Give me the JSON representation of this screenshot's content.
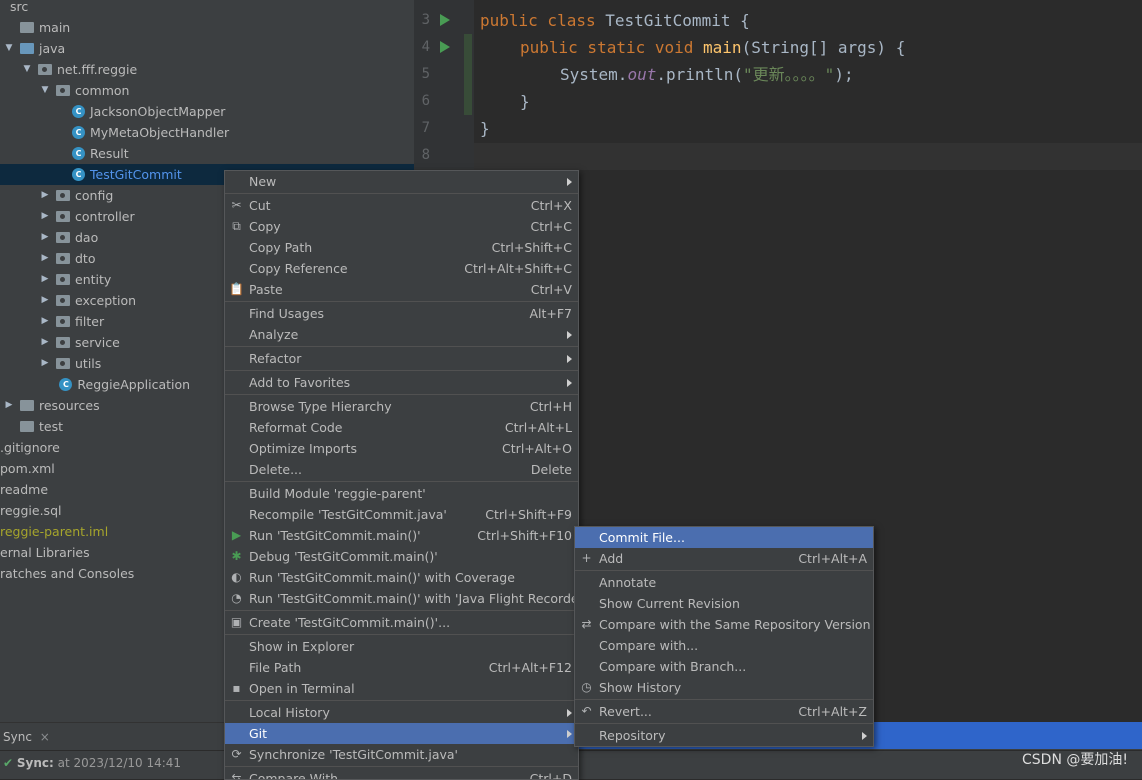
{
  "tree": [
    {
      "label": "src",
      "depth": 0,
      "arrow": "",
      "icon": "none",
      "color": "normal"
    },
    {
      "label": "main",
      "depth": 0,
      "arrow": "",
      "icon": "folder",
      "color": "normal"
    },
    {
      "label": "java",
      "depth": 0,
      "arrow": "down",
      "icon": "folder-blue",
      "color": "normal"
    },
    {
      "label": "net.fff.reggie",
      "depth": 1,
      "arrow": "down",
      "icon": "package",
      "color": "normal"
    },
    {
      "label": "common",
      "depth": 2,
      "arrow": "down",
      "icon": "package",
      "color": "normal"
    },
    {
      "label": "JacksonObjectMapper",
      "depth": 3,
      "arrow": "",
      "icon": "class",
      "color": "normal"
    },
    {
      "label": "MyMetaObjectHandler",
      "depth": 3,
      "arrow": "",
      "icon": "class",
      "color": "normal"
    },
    {
      "label": "Result",
      "depth": 3,
      "arrow": "",
      "icon": "class",
      "color": "normal"
    },
    {
      "label": "TestGitCommit",
      "depth": 3,
      "arrow": "",
      "icon": "class",
      "color": "blue",
      "selected": true
    },
    {
      "label": "config",
      "depth": 2,
      "arrow": "right",
      "icon": "package",
      "color": "normal"
    },
    {
      "label": "controller",
      "depth": 2,
      "arrow": "right",
      "icon": "package",
      "color": "normal"
    },
    {
      "label": "dao",
      "depth": 2,
      "arrow": "right",
      "icon": "package",
      "color": "normal"
    },
    {
      "label": "dto",
      "depth": 2,
      "arrow": "right",
      "icon": "package",
      "color": "normal"
    },
    {
      "label": "entity",
      "depth": 2,
      "arrow": "right",
      "icon": "package",
      "color": "normal"
    },
    {
      "label": "exception",
      "depth": 2,
      "arrow": "right",
      "icon": "package",
      "color": "normal"
    },
    {
      "label": "filter",
      "depth": 2,
      "arrow": "right",
      "icon": "package",
      "color": "normal"
    },
    {
      "label": "service",
      "depth": 2,
      "arrow": "right",
      "icon": "package",
      "color": "normal"
    },
    {
      "label": "utils",
      "depth": 2,
      "arrow": "right",
      "icon": "package",
      "color": "normal"
    },
    {
      "label": "ReggieApplication",
      "depth": 2.3,
      "arrow": "",
      "icon": "class",
      "color": "normal"
    },
    {
      "label": "resources",
      "depth": 0,
      "arrow": "right",
      "icon": "folder",
      "color": "normal"
    },
    {
      "label": "test",
      "depth": 0,
      "arrow": "",
      "icon": "folder",
      "color": "normal"
    },
    {
      "label": ".gitignore",
      "depth": -1,
      "arrow": "",
      "icon": "none",
      "color": "normal"
    },
    {
      "label": "pom.xml",
      "depth": -1,
      "arrow": "",
      "icon": "none",
      "color": "normal"
    },
    {
      "label": "readme",
      "depth": -1,
      "arrow": "",
      "icon": "none",
      "color": "normal"
    },
    {
      "label": "reggie.sql",
      "depth": -1,
      "arrow": "",
      "icon": "none",
      "color": "normal"
    },
    {
      "label": "reggie-parent.iml",
      "depth": -1,
      "arrow": "",
      "icon": "none",
      "color": "yellow"
    },
    {
      "label": "ernal Libraries",
      "depth": -1.3,
      "arrow": "",
      "icon": "none",
      "color": "normal"
    },
    {
      "label": "ratches and Consoles",
      "depth": -1.3,
      "arrow": "",
      "icon": "none",
      "color": "normal"
    }
  ],
  "editor": {
    "lines": [
      {
        "num": "3",
        "run": true
      },
      {
        "num": "4",
        "run": true
      },
      {
        "num": "5",
        "run": false
      },
      {
        "num": "6",
        "run": false
      },
      {
        "num": "7",
        "run": false
      },
      {
        "num": "8",
        "run": false
      }
    ],
    "code": {
      "l3": [
        "public class ",
        "TestGitCommit",
        " {"
      ],
      "l4": [
        "public static void ",
        "main",
        "(String[] args) {"
      ],
      "l5": [
        "System.",
        "out",
        ".println(",
        "\"更新。。。。\"",
        ");"
      ],
      "l6": "}",
      "l7": "}"
    }
  },
  "menu": [
    {
      "label": "New",
      "shortcut": "",
      "submenu": true,
      "icon": ""
    },
    {
      "sep": true
    },
    {
      "label": "Cut",
      "shortcut": "Ctrl+X",
      "icon": "✂"
    },
    {
      "label": "Copy",
      "shortcut": "Ctrl+C",
      "icon": "⧉"
    },
    {
      "label": "Copy Path",
      "shortcut": "Ctrl+Shift+C",
      "icon": ""
    },
    {
      "label": "Copy Reference",
      "shortcut": "Ctrl+Alt+Shift+C",
      "icon": ""
    },
    {
      "label": "Paste",
      "shortcut": "Ctrl+V",
      "icon": "📋"
    },
    {
      "sep": true
    },
    {
      "label": "Find Usages",
      "shortcut": "Alt+F7",
      "icon": ""
    },
    {
      "label": "Analyze",
      "shortcut": "",
      "submenu": true,
      "icon": ""
    },
    {
      "sep": true
    },
    {
      "label": "Refactor",
      "shortcut": "",
      "submenu": true,
      "icon": ""
    },
    {
      "sep": true
    },
    {
      "label": "Add to Favorites",
      "shortcut": "",
      "submenu": true,
      "icon": ""
    },
    {
      "sep": true
    },
    {
      "label": "Browse Type Hierarchy",
      "shortcut": "Ctrl+H",
      "icon": ""
    },
    {
      "label": "Reformat Code",
      "shortcut": "Ctrl+Alt+L",
      "icon": ""
    },
    {
      "label": "Optimize Imports",
      "shortcut": "Ctrl+Alt+O",
      "icon": ""
    },
    {
      "label": "Delete...",
      "shortcut": "Delete",
      "icon": ""
    },
    {
      "sep": true
    },
    {
      "label": "Build Module 'reggie-parent'",
      "shortcut": "",
      "icon": ""
    },
    {
      "label": "Recompile 'TestGitCommit.java'",
      "shortcut": "Ctrl+Shift+F9",
      "icon": ""
    },
    {
      "label": "Run 'TestGitCommit.main()'",
      "shortcut": "Ctrl+Shift+F10",
      "icon": "▶"
    },
    {
      "label": "Debug 'TestGitCommit.main()'",
      "shortcut": "",
      "icon": "✱"
    },
    {
      "label": "Run 'TestGitCommit.main()' with Coverage",
      "shortcut": "",
      "icon": "◐"
    },
    {
      "label": "Run 'TestGitCommit.main()' with 'Java Flight Recorder'",
      "shortcut": "",
      "icon": "◔"
    },
    {
      "sep": true
    },
    {
      "label": "Create 'TestGitCommit.main()'...",
      "shortcut": "",
      "icon": "▣"
    },
    {
      "sep": true
    },
    {
      "label": "Show in Explorer",
      "shortcut": "",
      "icon": ""
    },
    {
      "label": "File Path",
      "shortcut": "Ctrl+Alt+F12",
      "icon": ""
    },
    {
      "label": "Open in Terminal",
      "shortcut": "",
      "icon": "▪"
    },
    {
      "sep": true
    },
    {
      "label": "Local History",
      "shortcut": "",
      "submenu": true,
      "icon": ""
    },
    {
      "label": "Git",
      "shortcut": "",
      "submenu": true,
      "icon": "",
      "selected": true
    },
    {
      "label": "Synchronize 'TestGitCommit.java'",
      "shortcut": "",
      "icon": "⟳"
    },
    {
      "sep": true
    },
    {
      "label": "Compare With...",
      "shortcut": "Ctrl+D",
      "icon": "⇆"
    }
  ],
  "gitmenu": [
    {
      "label": "Commit File...",
      "shortcut": "",
      "icon": "",
      "selected": true
    },
    {
      "label": "Add",
      "shortcut": "Ctrl+Alt+A",
      "icon": "+"
    },
    {
      "sep": true
    },
    {
      "label": "Annotate",
      "shortcut": "",
      "icon": ""
    },
    {
      "label": "Show Current Revision",
      "shortcut": "",
      "icon": ""
    },
    {
      "label": "Compare with the Same Repository Version",
      "shortcut": "",
      "icon": "⇄"
    },
    {
      "label": "Compare with...",
      "shortcut": "",
      "icon": ""
    },
    {
      "label": "Compare with Branch...",
      "shortcut": "",
      "icon": ""
    },
    {
      "label": "Show History",
      "shortcut": "",
      "icon": "◷"
    },
    {
      "sep": true
    },
    {
      "label": "Revert...",
      "shortcut": "Ctrl+Alt+Z",
      "icon": "↶"
    },
    {
      "sep": true
    },
    {
      "label": "Repository",
      "shortcut": "",
      "submenu": true,
      "icon": ""
    }
  ],
  "bottom": {
    "tab": "Sync",
    "close": "×",
    "status_bold": "Sync:",
    "status_rest": " at 2023/12/10 14:41"
  },
  "watermark": "CSDN @要加油!",
  "colors": {
    "accent": "#4b6eaf",
    "selection": "#0d293e",
    "run": "#499c54"
  }
}
